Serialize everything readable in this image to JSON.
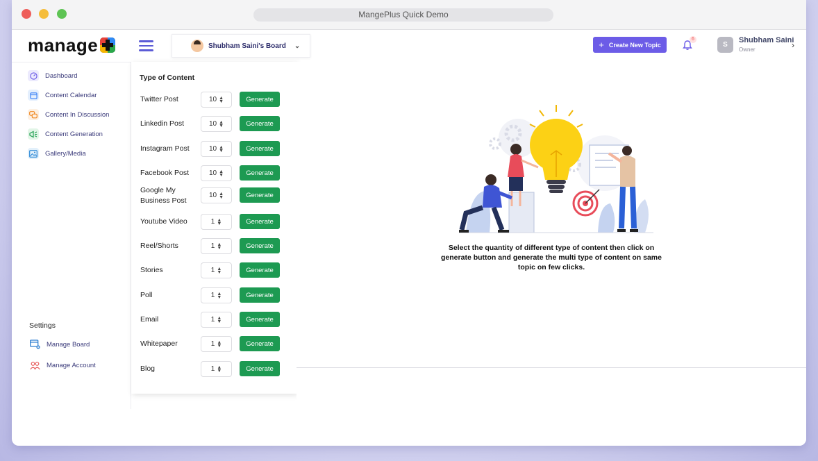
{
  "window": {
    "url_title": "MangePlus Quick Demo"
  },
  "brand": {
    "logo_text": "manage"
  },
  "header": {
    "board_name": "Shubham Saini's Board",
    "create_button": "Create New Topic",
    "notification_count": "6",
    "user_initial": "S",
    "user_name": "Shubham Saini",
    "user_role": "Owner"
  },
  "sidebar": {
    "items": [
      {
        "label": "Dashboard",
        "icon": "dashboard-icon",
        "color": "#eceafd"
      },
      {
        "label": "Content Calendar",
        "icon": "calendar-icon",
        "color": "#e4effd"
      },
      {
        "label": "Content In Discussion",
        "icon": "chat-icon",
        "color": "#fdf0e2"
      },
      {
        "label": "Content Generation",
        "icon": "megaphone-icon",
        "color": "#e2f5e7"
      },
      {
        "label": "Gallery/Media",
        "icon": "image-icon",
        "color": "#e2f0fb"
      }
    ],
    "settings_title": "Settings",
    "settings_items": [
      {
        "label": "Manage Board",
        "icon": "board-icon"
      },
      {
        "label": "Manage Account",
        "icon": "account-icon"
      }
    ]
  },
  "panel": {
    "title": "Type of Content",
    "generate_label": "Generate",
    "rows": [
      {
        "label": "Twitter Post",
        "qty": "10"
      },
      {
        "label": "Linkedin Post",
        "qty": "10"
      },
      {
        "label": "Instagram Post",
        "qty": "10"
      },
      {
        "label": "Facebook Post",
        "qty": "10"
      },
      {
        "label": "Google My Business Post",
        "qty": "10"
      },
      {
        "label": "Youtube Video",
        "qty": "1"
      },
      {
        "label": "Reel/Shorts",
        "qty": "1"
      },
      {
        "label": "Stories",
        "qty": "1"
      },
      {
        "label": "Poll",
        "qty": "1"
      },
      {
        "label": "Email",
        "qty": "1"
      },
      {
        "label": "Whitepaper",
        "qty": "1"
      },
      {
        "label": "Blog",
        "qty": "1"
      }
    ]
  },
  "main": {
    "description": "Select the quantity of different type of content then click on generate button and generate the multi type of content on same topic on few clicks."
  },
  "colors": {
    "accent": "#6c5ce7",
    "generate": "#1d9a52",
    "nav_text": "#3a3a7a"
  }
}
